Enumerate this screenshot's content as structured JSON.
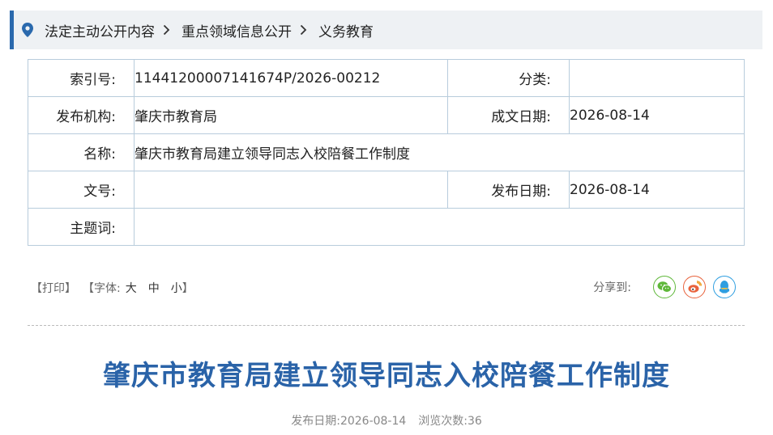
{
  "breadcrumb": {
    "items": [
      "法定主动公开内容",
      "重点领域信息公开",
      "义务教育"
    ]
  },
  "meta": {
    "index_label": "索引号:",
    "index_value": "11441200007141674P/2026-00212",
    "category_label": "分类:",
    "category_value": "",
    "publisher_label": "发布机构:",
    "publisher_value": "肇庆市教育局",
    "created_label": "成文日期:",
    "created_value": "2026-08-14",
    "name_label": "名称:",
    "name_value": "肇庆市教育局建立领导同志入校陪餐工作制度",
    "docno_label": "文号:",
    "docno_value": "",
    "pubdate_label": "发布日期:",
    "pubdate_value": "2026-08-14",
    "keywords_label": "主题词:",
    "keywords_value": ""
  },
  "toolbar": {
    "print": "【打印】",
    "font_prefix": "【字体:",
    "font_large": "大",
    "font_medium": "中",
    "font_small": "小",
    "font_suffix": "】"
  },
  "share": {
    "label": "分享到:",
    "icons": [
      "wechat-icon",
      "weibo-icon",
      "qq-icon"
    ],
    "colors": {
      "wechat": "#5fb83a",
      "weibo": "#e8623c",
      "qq": "#2e9ee0"
    }
  },
  "article": {
    "title": "肇庆市教育局建立领导同志入校陪餐工作制度",
    "pub_label": "发布日期:",
    "pub_date": "2026-08-14",
    "views_label": "浏览次数:",
    "views": "36"
  },
  "colors": {
    "accent": "#2a69ad",
    "title": "#2a63a8",
    "border": "#b8ccdc"
  }
}
